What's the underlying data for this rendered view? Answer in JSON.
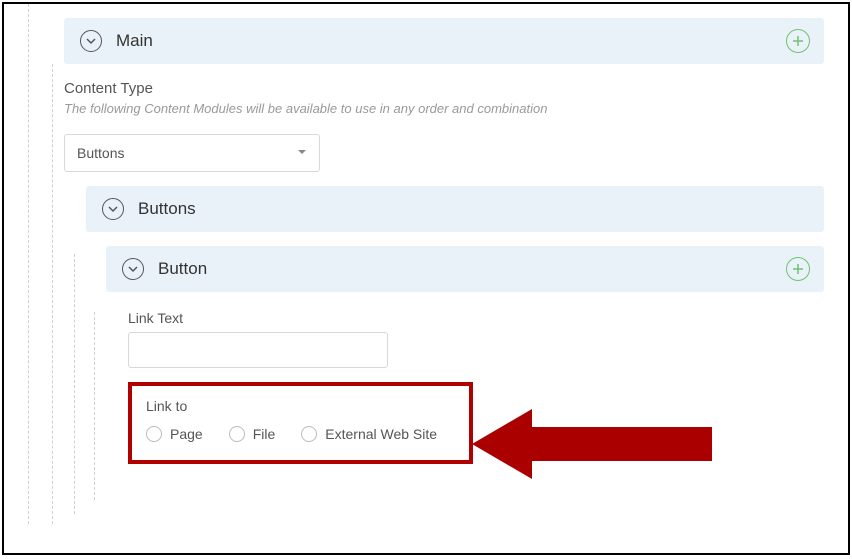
{
  "colors": {
    "highlight": "#b00000",
    "accent_green": "#6dc36d",
    "panel_bg": "#eaf2f9"
  },
  "panels": {
    "main": {
      "title": "Main"
    },
    "buttons": {
      "title": "Buttons"
    },
    "button": {
      "title": "Button"
    }
  },
  "content_type": {
    "label": "Content Type",
    "helper": "The following Content Modules will be available to use in any order and combination",
    "selected": "Buttons"
  },
  "link_text": {
    "label": "Link Text",
    "value": ""
  },
  "link_to": {
    "label": "Link to",
    "options": [
      {
        "label": "Page"
      },
      {
        "label": "File"
      },
      {
        "label": "External Web Site"
      }
    ]
  }
}
